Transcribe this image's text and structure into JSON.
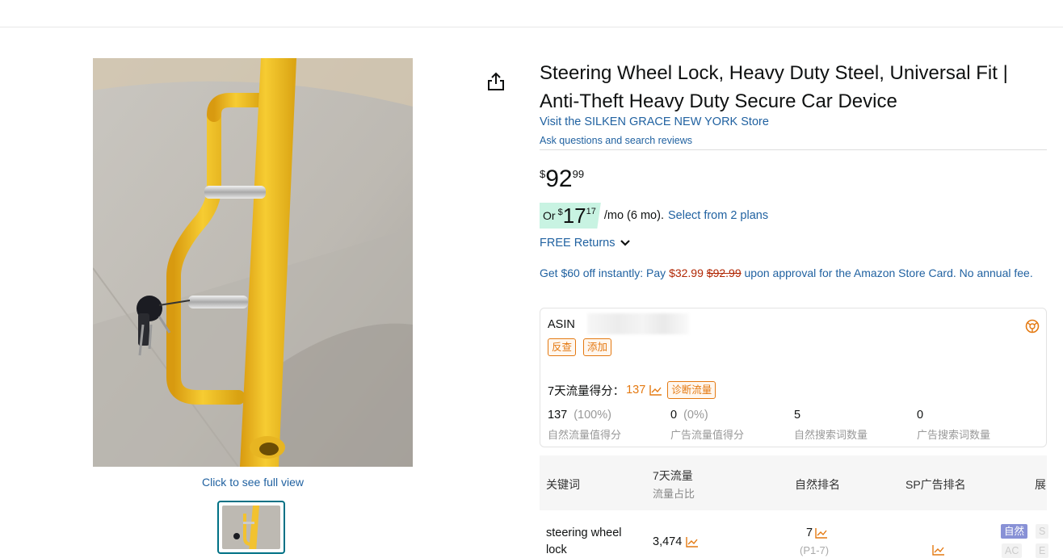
{
  "product": {
    "title": "Steering Wheel Lock, Heavy Duty Steel, Universal Fit | Anti-Theft Heavy Duty Secure Car Device",
    "store_link": "Visit the SILKEN GRACE NEW YORK Store",
    "ask_link": "Ask questions and search reviews",
    "full_view_link": "Click to see full view"
  },
  "price": {
    "symbol": "$",
    "whole": "92",
    "fraction": "99"
  },
  "monthly": {
    "prefix": "Or",
    "symbol": "$",
    "whole": "17",
    "fraction": "17",
    "suffix": "/mo (6 mo).",
    "plans_link": "Select from 2 plans"
  },
  "returns": {
    "label": "FREE Returns"
  },
  "promo": {
    "text_before": "Get $60 off instantly: Pay ",
    "new_price": "$32.99",
    "old_price": "$92.99",
    "text_after": " upon approval for the Amazon Store Card. No annual fee."
  },
  "plugin": {
    "asin_label": "ASIN",
    "reverse_btn": "反查",
    "add_btn": "添加",
    "score_label": "7天流量得分：",
    "score_value": "137",
    "diagnose_btn": "诊断流量",
    "stats": [
      {
        "value": "137",
        "pct": "(100%)",
        "label": "自然流量值得分"
      },
      {
        "value": "0",
        "pct": "(0%)",
        "label": "广告流量值得分"
      },
      {
        "value": "5",
        "pct": "",
        "label": "自然搜索词数量"
      },
      {
        "value": "0",
        "pct": "",
        "label": "广告搜索词数量"
      }
    ]
  },
  "keyword_table": {
    "headers": {
      "keyword": "关键词",
      "traffic": "7天流量",
      "traffic_share": "流量占比",
      "organic_rank": "自然排名",
      "sp_rank": "SP广告排名",
      "more": "展"
    },
    "row": {
      "keyword": "steering wheel",
      "keyword_cont": "lock",
      "traffic": "3,474",
      "organic_rank": "7",
      "organic_sub": "(P1-7)",
      "chip_organic": "自然",
      "chip_s": "S",
      "chip_ac": "AC",
      "chip_e": "E"
    }
  },
  "colors": {
    "link": "#2162a1",
    "orange": "#e47911",
    "price_red": "#b12704",
    "badge_green": "#c8f3e2",
    "product_yellow": "#f2c230"
  }
}
